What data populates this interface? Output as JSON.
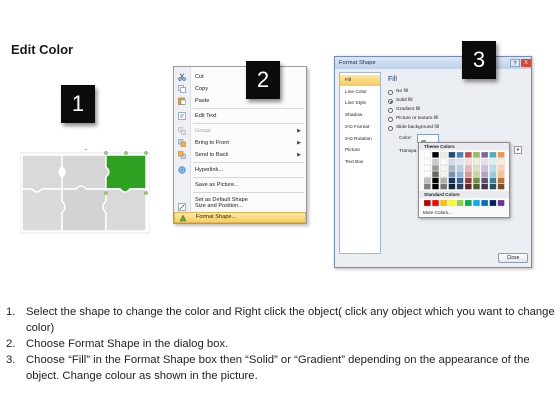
{
  "title": "Edit Color",
  "badges": [
    "1",
    "2",
    "3"
  ],
  "colors": {
    "puzzle_piece": "#d9d9d9",
    "puzzle_selected": "#2ea122",
    "badge_bg": "#0b0b0b",
    "menu_highlight": "#f7cf5f",
    "dialog_border": "#6f8db8"
  },
  "context_menu": {
    "items": [
      {
        "label": "Cut",
        "icon": "scissors-icon",
        "enabled": true,
        "submenu": false
      },
      {
        "label": "Copy",
        "icon": "copy-icon",
        "enabled": true,
        "submenu": false
      },
      {
        "label": "Paste",
        "icon": "clipboard-icon",
        "enabled": true,
        "submenu": false
      },
      {
        "label": "Edit Text",
        "icon": "text-box-icon",
        "enabled": true,
        "submenu": false
      },
      {
        "label": "Group",
        "icon": "group-icon",
        "enabled": false,
        "submenu": true
      },
      {
        "label": "Bring to Front",
        "icon": "bring-front-icon",
        "enabled": true,
        "submenu": true
      },
      {
        "label": "Send to Back",
        "icon": "send-back-icon",
        "enabled": true,
        "submenu": true
      },
      {
        "label": "Hyperlink...",
        "icon": "hyperlink-icon",
        "enabled": true,
        "submenu": false
      },
      {
        "label": "Save as Picture...",
        "icon": "",
        "enabled": true,
        "submenu": false
      },
      {
        "label": "Set as Default Shape",
        "icon": "",
        "enabled": true,
        "submenu": false
      },
      {
        "label": "Size and Position...",
        "icon": "size-position-icon",
        "enabled": true,
        "submenu": false
      },
      {
        "label": "Format Shape...",
        "icon": "format-shape-icon",
        "enabled": true,
        "submenu": false,
        "highlighted": true
      }
    ]
  },
  "dialog": {
    "title": "Format Shape",
    "help": "?",
    "close": "X",
    "nav": [
      "Fill",
      "Line Color",
      "Line Style",
      "Shadow",
      "3-D Format",
      "3-D Rotation",
      "Picture",
      "Text Box"
    ],
    "selected_nav": "Fill",
    "section": "Fill",
    "options": [
      {
        "label": "No fill",
        "selected": false
      },
      {
        "label": "Solid fill",
        "selected": true
      },
      {
        "label": "Gradient fill",
        "selected": false
      },
      {
        "label": "Picture or texture fill",
        "selected": false
      },
      {
        "label": "Slide background fill",
        "selected": false
      }
    ],
    "fill_color_label": "Color:",
    "transparency_label": "Transpa",
    "palette": {
      "theme_label": "Theme Colors",
      "standard_label": "Standard Colors",
      "more_label": "More Colors...",
      "theme_top": [
        "#ffffff",
        "#000000",
        "#eeece1",
        "#1f497d",
        "#4f81bd",
        "#c0504d",
        "#9bbb59",
        "#8064a2",
        "#4bacc6",
        "#f79646"
      ],
      "standard": [
        "#c00000",
        "#ff0000",
        "#ffc000",
        "#ffff00",
        "#92d050",
        "#00b050",
        "#00b0f0",
        "#0070c0",
        "#002060",
        "#7030a0"
      ]
    },
    "close_button": "Close"
  },
  "instructions": [
    {
      "num": "1.",
      "text": "Select the shape to change the color and Right click the object( click any object which you want to change color)"
    },
    {
      "num": "2.",
      "text": "Choose Format Shape in the dialog box."
    },
    {
      "num": "3.",
      "text": "Choose “Fill” in the Format Shape box then “Solid” or “Gradient” depending on the appearance of the object. Change colour as shown in the picture."
    }
  ]
}
